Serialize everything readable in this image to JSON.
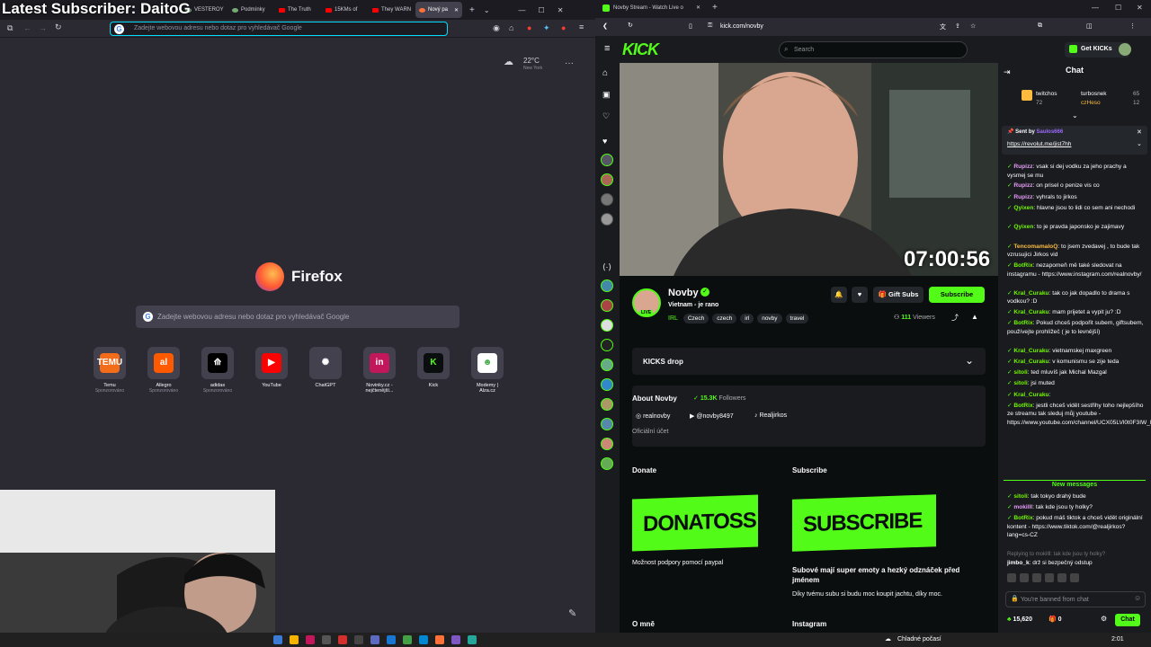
{
  "overlay": {
    "title": "Latest Subscriber: DaitoG"
  },
  "firefox": {
    "tabs": [
      {
        "label": "VESTEROY"
      },
      {
        "label": "Podmínky"
      },
      {
        "label": "The Truth"
      },
      {
        "label": "15KMs of"
      },
      {
        "label": "They WARN"
      },
      {
        "label": "Nový pa"
      }
    ],
    "url_placeholder": "Zadejte webovou adresu nebo dotaz pro vyhledávač Google",
    "weather": {
      "temp": "22°C",
      "city": "New York"
    },
    "logo_text": "Firefox",
    "search_placeholder": "Zadejte webovou adresu nebo dotaz pro vyhledávač Google",
    "shortcuts": [
      {
        "label": "Temu",
        "sub": "Sponzorováno",
        "icon": "TEMU",
        "color": "#f26c1a"
      },
      {
        "label": "Allegro",
        "sub": "Sponzorováno",
        "icon": "al",
        "color": "#ff5a00"
      },
      {
        "label": "adidas",
        "sub": "Sponzorováno",
        "icon": "⟰",
        "color": "#000000"
      },
      {
        "label": "YouTube",
        "sub": "",
        "icon": "▶",
        "color": "#ff0000"
      },
      {
        "label": "ChatGPT",
        "sub": "",
        "icon": "✺",
        "color": "#42414d"
      },
      {
        "label": "Novinky.cz - nejčtenější...",
        "sub": "",
        "icon": "in",
        "color": "#c2185b"
      },
      {
        "label": "Kick",
        "sub": "",
        "icon": "K",
        "color": "#0b0e0f"
      },
      {
        "label": "Modemy | Alza.cz",
        "sub": "",
        "icon": "☻",
        "color": "#ffffff"
      }
    ]
  },
  "kick": {
    "tab_label": "Novby Stream - Watch Live o",
    "url": "kick.com/novby",
    "search_placeholder": "Search",
    "get_kicks": "Get KICKs",
    "timer": "07:00:56",
    "channel": {
      "name": "Novby",
      "title": "Vietnam - je rano",
      "category": "IRL",
      "tags": [
        "Czech",
        "czech",
        "irl",
        "novby",
        "travel"
      ],
      "viewers": "111",
      "viewers_label": "Viewers",
      "live_badge": "LIVE"
    },
    "buttons": {
      "gift": "Gift Subs",
      "subscribe": "Subscribe"
    },
    "kicks_drop": "KICKS drop",
    "about": {
      "title": "About Novby",
      "followers": "15.3K",
      "followers_label": "Followers",
      "socials": [
        "realnovby",
        "@novby8497",
        "Realjirkos"
      ],
      "official": "Oficiální účet"
    },
    "donate": {
      "title": "Donate",
      "banner": "DONATOSS",
      "desc": "Možnost podpory pomocí paypal"
    },
    "subscribe_panel": {
      "title": "Subscribe",
      "banner": "SUBSCRIBE",
      "heading": "Subové mají super emoty a hezký odznáček před jménem",
      "desc": "Díky tvému subu si budu moc koupit jachtu, díky moc."
    },
    "about_me": "O mně",
    "instagram": "Instagram"
  },
  "chat": {
    "title": "Chat",
    "leaders": [
      {
        "name": "twitchos",
        "count": "72"
      },
      {
        "name": "turbosnek",
        "count": "65"
      },
      {
        "name": "czHeso",
        "count": "12"
      }
    ],
    "pinned": {
      "sent_by": "Sent by",
      "user": "Saulos666",
      "link": "https://revolut.me/jist7hh"
    },
    "messages": [
      {
        "user": "Rupizz",
        "color": "#e59df6",
        "text": "vsak si dej vodku za jeho prachy a vysmej se mu"
      },
      {
        "user": "Rupizz",
        "color": "#e59df6",
        "text": "on prisel o penize vis co"
      },
      {
        "user": "Rupizz",
        "color": "#e59df6",
        "text": "vyhrals to jirkos"
      },
      {
        "user": "Qyixen",
        "color": "#72f700",
        "text": "hlavne jsou to lidi co sem ani nechodi"
      },
      {
        "user": "Qyixen",
        "color": "#72f700",
        "text": "to je pravda japonsko je zajimavy"
      },
      {
        "user": "TencomamaloQ",
        "color": "#fcbb3f",
        "text": "to jsem zvedavej , to bude tak vzrusujici Jirkos vid"
      },
      {
        "user": "BotRix",
        "color": "#72f700",
        "text": "nezapomeň mě také sledovat na instagramu - https://www.instagram.com/realnovby/"
      },
      {
        "user": "Kral_Curaku",
        "color": "#72f700",
        "text": "tak co jak dopadlo to drama s vodkou? :D"
      },
      {
        "user": "Kral_Curaku",
        "color": "#72f700",
        "text": "mam prijetet a vypit ju? :D"
      },
      {
        "user": "BotRix",
        "color": "#72f700",
        "text": "Pokud chceš podpořit subem, giftsubem, používejte prohlížeč ( je to levnější)"
      },
      {
        "user": "Kral_Curaku",
        "color": "#72f700",
        "text": "vietnamskej maxgreen"
      },
      {
        "user": "Kral_Curaku",
        "color": "#72f700",
        "text": "v komunismu se zije teda"
      },
      {
        "user": "sitoli",
        "color": "#72f700",
        "text": "ted mluvíš jak Michal Mazgal"
      },
      {
        "user": "sitoli",
        "color": "#72f700",
        "text": "jsi muted"
      },
      {
        "user": "Kral_Curaku",
        "color": "#72f700",
        "text": ""
      },
      {
        "user": "BotRix",
        "color": "#72f700",
        "text": "jestli chceš vidět sestřihy toho nejlepšího ze streamu tak sleduj můj youtube - https://www.youtube.com/channel/UCX05LVl0t0F3IW_bT3RStMw"
      }
    ],
    "new_messages": "New messages",
    "new": [
      {
        "user": "sitoli",
        "color": "#72f700",
        "text": "tak tokyo drahý bude"
      },
      {
        "user": "mokilll",
        "color": "#e59df6",
        "text": "tak kde jsou ty holky?"
      },
      {
        "user": "BotRix",
        "color": "#72f700",
        "text": "pokud máš tiktok a chceš vidět originální kontent - https://www.tiktok.com/@realjirkos?lang=cs-CZ"
      }
    ],
    "reply_note": "Replying to mokilll: tak kde jsou ty holky?",
    "last": {
      "user": "jimbo_k",
      "text": "drž si bezpečný odstup"
    },
    "input_placeholder": "You're banned from chat",
    "kicks_balance": "15,620",
    "other_count": "0",
    "send": "Chat"
  },
  "taskbar": {
    "weather": "Chladné počasí",
    "time": "2:01"
  }
}
